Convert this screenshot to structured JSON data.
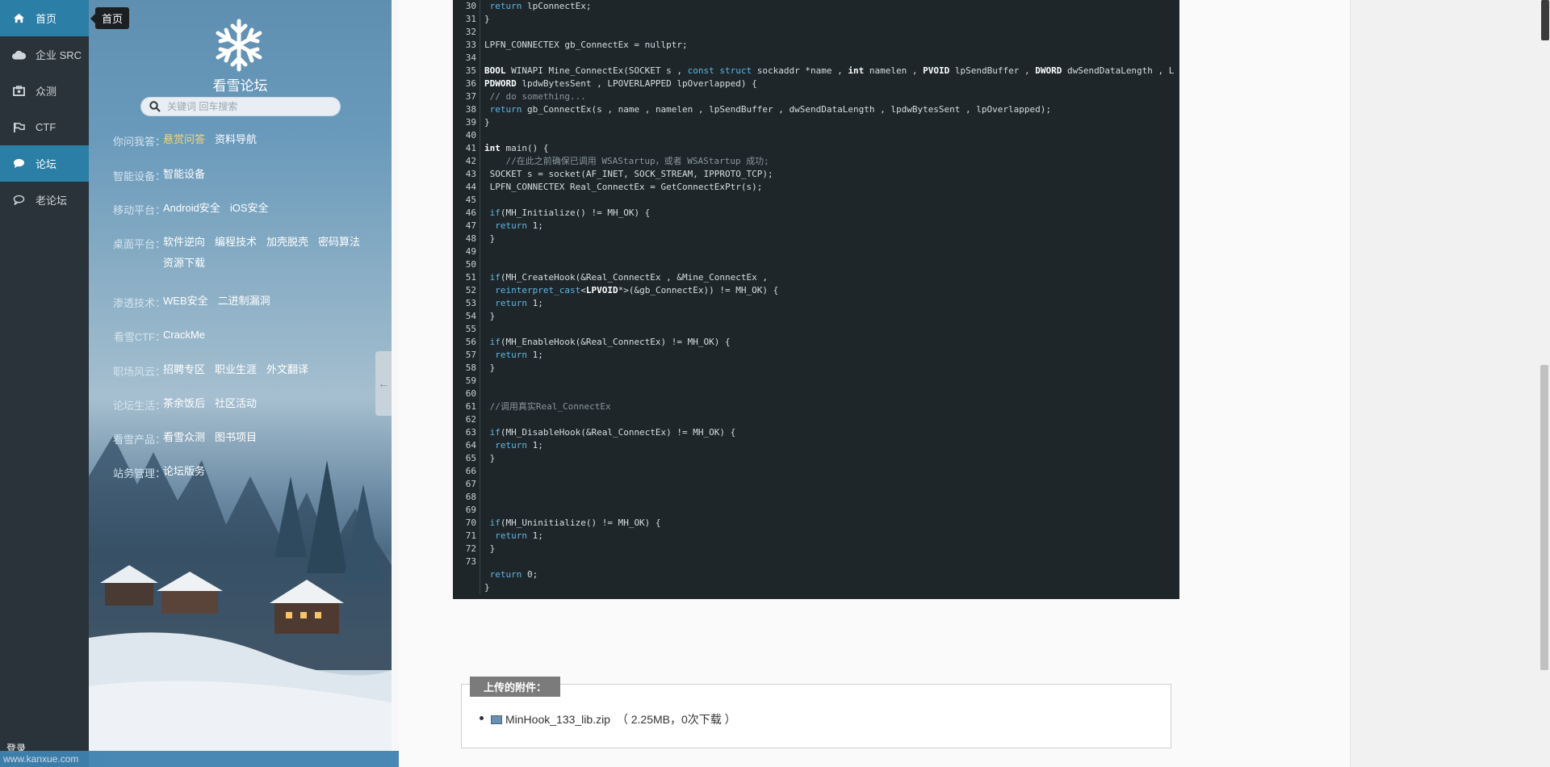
{
  "nav": {
    "items": [
      {
        "label": "首页",
        "icon": "home-icon"
      },
      {
        "label": "企业 SRC",
        "icon": "cloud-icon"
      },
      {
        "label": "众测",
        "icon": "briefcase-icon"
      },
      {
        "label": "CTF",
        "icon": "flag-icon"
      },
      {
        "label": "论坛",
        "icon": "chat-filled-icon"
      },
      {
        "label": "老论坛",
        "icon": "chat-outline-icon"
      }
    ],
    "tooltip": "首页",
    "login": "登录"
  },
  "panel": {
    "brand": "看雪论坛",
    "search_placeholder": "关键词 回车搜索",
    "categories": [
      {
        "key": "你问我答",
        "links": [
          "悬赏问答",
          "资料导航"
        ]
      },
      {
        "key": "智能设备",
        "links": [
          "智能设备"
        ]
      },
      {
        "key": "移动平台",
        "links": [
          "Android安全",
          "iOS安全"
        ]
      },
      {
        "key": "桌面平台",
        "links": [
          "软件逆向",
          "编程技术",
          "加壳脱壳",
          "密码算法",
          "资源下载"
        ]
      },
      {
        "key": "渗透技术",
        "links": [
          "WEB安全",
          "二进制漏洞"
        ]
      },
      {
        "key": "看雪CTF",
        "links": [
          "CrackMe"
        ]
      },
      {
        "key": "职场风云",
        "links": [
          "招聘专区",
          "职业生涯",
          "外文翻译"
        ]
      },
      {
        "key": "论坛生活",
        "links": [
          "茶余饭后",
          "社区活动"
        ]
      },
      {
        "key": "看雪产品",
        "links": [
          "看雪众测",
          "图书项目"
        ]
      },
      {
        "key": "站务管理",
        "links": [
          "论坛版务"
        ]
      }
    ],
    "url": "www.kanxue.com"
  },
  "code": {
    "line_numbers": [
      "30",
      "31",
      "32",
      "33",
      "34",
      "35",
      "36",
      "37",
      "38",
      "39",
      "40",
      "41",
      "42",
      "43",
      "44",
      "45",
      "46",
      "47",
      "48",
      "49",
      "50",
      "51",
      "52",
      "53",
      "54",
      "55",
      "56",
      "57",
      "58",
      "59",
      "60",
      "61",
      "62",
      "63",
      "64",
      "65",
      "66",
      "67",
      "68",
      "69",
      "70",
      "71",
      "72",
      "73",
      "",
      ""
    ],
    "lines": [
      " return lpConnectEx;",
      "}",
      "",
      "LPFN_CONNECTEX gb_ConnectEx = nullptr;",
      "",
      "BOOL WINAPI Mine_ConnectEx(SOCKET s , const struct sockaddr *name , int namelen , PVOID lpSendBuffer , DWORD dwSendDataLength , L",
      "PDWORD lpdwBytesSent , LPOVERLAPPED lpOverlapped) {",
      " // do something...",
      " return gb_ConnectEx(s , name , namelen , lpSendBuffer , dwSendDataLength , lpdwBytesSent , lpOverlapped);",
      "}",
      "",
      "int main() {",
      "    //在此之前确保已调用 WSAStartup，或者 WSAStartup 成功;",
      " SOCKET s = socket(AF_INET, SOCK_STREAM, IPPROTO_TCP);",
      " LPFN_CONNECTEX Real_ConnectEx = GetConnectExPtr(s);",
      "",
      " if(MH_Initialize() != MH_OK) {",
      "  return 1;",
      " }",
      "",
      "",
      " if(MH_CreateHook(&Real_ConnectEx , &Mine_ConnectEx ,",
      "  reinterpret_cast<LPVOID*>(&gb_ConnectEx)) != MH_OK) {",
      "  return 1;",
      " }",
      "",
      " if(MH_EnableHook(&Real_ConnectEx) != MH_OK) {",
      "  return 1;",
      " }",
      "",
      "",
      " //调用真实Real_ConnectEx",
      "",
      " if(MH_DisableHook(&Real_ConnectEx) != MH_OK) {",
      "  return 1;",
      " }",
      "",
      "",
      "",
      "",
      " if(MH_Uninitialize() != MH_OK) {",
      "  return 1;",
      " }",
      "",
      " return 0;",
      "}"
    ]
  },
  "attachments": {
    "title": "上传的附件：",
    "file": "MinHook_133_lib.zip",
    "meta": "（ 2.25MB，0次下载 ）"
  },
  "colors": {
    "nav_bg": "#2a3339",
    "nav_active": "#2b7ea6",
    "code_bg": "#1e2629",
    "keyword": "#5eb6e6"
  }
}
